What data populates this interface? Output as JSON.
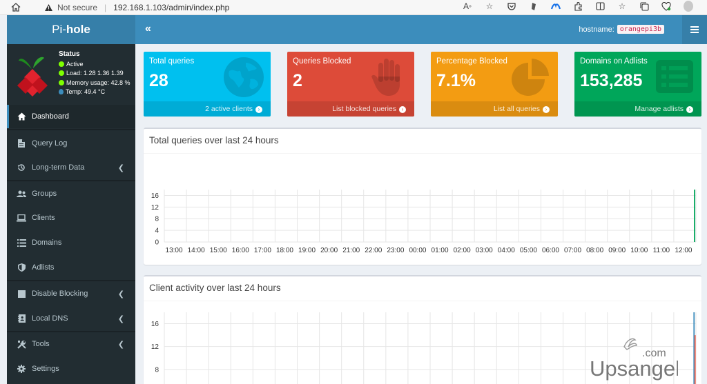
{
  "browser": {
    "security": "Not secure",
    "url": "192.168.1.103/admin/index.php",
    "icons": [
      "read-aloud-icon",
      "favorite-icon",
      "pocket-icon",
      "extension-icon",
      "extension-icon",
      "extension-icon",
      "split-screen-icon",
      "favorites-bar-icon",
      "collections-icon",
      "browser-essentials-icon",
      "profile-icon"
    ]
  },
  "header": {
    "brand_light": "Pi-",
    "brand_bold": "hole",
    "toggle": "«",
    "hostname_label": "hostname:",
    "hostname_value": "orangepi3b"
  },
  "status": {
    "title": "Status",
    "active": "Active",
    "load": "Load:  1.28  1.36  1.39",
    "memory": "Memory usage:  42.8 %",
    "temp": "Temp: 49.4 °C"
  },
  "sidebar": {
    "items": [
      {
        "label": "Dashboard",
        "icon": "home-icon"
      },
      {
        "label": "Query Log",
        "icon": "file-icon"
      },
      {
        "label": "Long-term Data",
        "icon": "history-icon"
      },
      {
        "label": "Groups",
        "icon": "users-icon"
      },
      {
        "label": "Clients",
        "icon": "laptop-icon"
      },
      {
        "label": "Domains",
        "icon": "list-icon"
      },
      {
        "label": "Adlists",
        "icon": "shield-icon"
      },
      {
        "label": "Disable Blocking",
        "icon": "stop-icon"
      },
      {
        "label": "Local DNS",
        "icon": "address-book-icon"
      },
      {
        "label": "Tools",
        "icon": "tools-icon"
      },
      {
        "label": "Settings",
        "icon": "gear-icon"
      }
    ]
  },
  "stats": [
    {
      "label": "Total queries",
      "value": "28",
      "footer": "2 active clients",
      "color": "#00c0ef",
      "icon": "globe-icon"
    },
    {
      "label": "Queries Blocked",
      "value": "2",
      "footer": "List blocked queries",
      "color": "#dd4b39",
      "icon": "hand-icon"
    },
    {
      "label": "Percentage Blocked",
      "value": "7.1%",
      "footer": "List all queries",
      "color": "#f39c12",
      "icon": "pie-chart-icon"
    },
    {
      "label": "Domains on Adlists",
      "value": "153,285",
      "footer": "Manage adlists",
      "color": "#00a65a",
      "icon": "list-alt-icon"
    }
  ],
  "watermark": {
    "text": "Upsangel",
    "tld": ".com"
  },
  "chart_data": [
    {
      "type": "line",
      "title": "Total queries over last 24 hours",
      "x": [
        "13:00",
        "14:00",
        "15:00",
        "16:00",
        "17:00",
        "18:00",
        "19:00",
        "20:00",
        "21:00",
        "22:00",
        "23:00",
        "00:00",
        "01:00",
        "02:00",
        "03:00",
        "04:00",
        "05:00",
        "06:00",
        "07:00",
        "08:00",
        "09:00",
        "10:00",
        "11:00",
        "12:00"
      ],
      "yticks": [
        0,
        4,
        8,
        12,
        16
      ],
      "ylim": [
        0,
        18
      ],
      "grid": true,
      "series": [
        {
          "color": "#00a65a",
          "final_value": 18
        }
      ]
    },
    {
      "type": "bar",
      "title": "Client activity over last 24 hours",
      "yticks": [
        4,
        8,
        12,
        16
      ],
      "ylim": [
        0,
        18
      ],
      "grid": true,
      "series": [
        {
          "color": "#3c8dbc",
          "final_value": 18
        },
        {
          "color": "#f56954",
          "final_value": 14
        }
      ]
    }
  ]
}
